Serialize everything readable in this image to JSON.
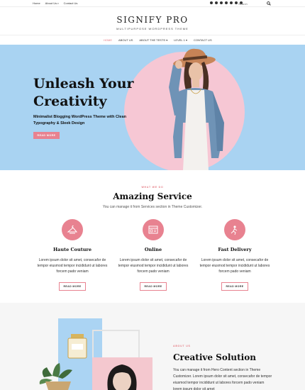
{
  "topbar": {
    "nav": [
      "Home",
      "About Us",
      "Contact Us"
    ],
    "search_placeholder": "Search",
    "social_icons": [
      "facebook-icon",
      "twitter-icon",
      "instagram-icon",
      "pinterest-icon",
      "youtube-icon",
      "linkedin-icon",
      "rss-icon"
    ]
  },
  "header": {
    "title": "SIGNIFY PRO",
    "tagline": "MULTIPURPOSE WORDPRESS THEME",
    "nav": [
      "HOME",
      "ABOUT US",
      "ABOUT THE TESTS",
      "LEVEL 1",
      "CONTACT US"
    ],
    "active_nav": "HOME"
  },
  "hero": {
    "title_line1": "Unleash Your",
    "title_line2": "Creativity",
    "subtitle": "Minimalist Blogging WordPress Theme with Clean Typography & Sleek Design",
    "button": "READ MORE",
    "colors": {
      "background": "#a9d3f2",
      "circle": "#f6c7d4",
      "button": "#e88290"
    }
  },
  "services": {
    "eyebrow": "WHAT WE DO",
    "title": "Amazing Service",
    "description": "You can manage it from Services section in Theme Customizer.",
    "items": [
      {
        "icon": "hanger-icon",
        "title": "Haute Couture",
        "text": "Lorem ipsum dolor sit amet, consecafor de tempor eiusmod tempor incididunt ut labores forcem pado veniam",
        "button": "READ MORE"
      },
      {
        "icon": "browser-window-icon",
        "title": "Online",
        "text": "Lorem ipsum dolor sit amet, consecafor de tempor eiusmod tempor incididunt ut labores forcem pado veniam",
        "button": "READ MORE"
      },
      {
        "icon": "delivery-icon",
        "title": "Fast Delivery",
        "text": "Lorem ipsum dolor sit amet, consecafor de tempor eiusmod tempor incididunt ut labores forcem pado veniam",
        "button": "READ MORE"
      }
    ]
  },
  "about": {
    "eyebrow": "ABOUT US",
    "title": "Creative Solution",
    "text": "You can manage it from Hero Content section in Theme Customizer. Lorem ipsum dolor sit amet, consecafor de tempor eiusmod tempor incididunt ut labores forcem pado veniam lorem ipsum dolor sit amet"
  }
}
